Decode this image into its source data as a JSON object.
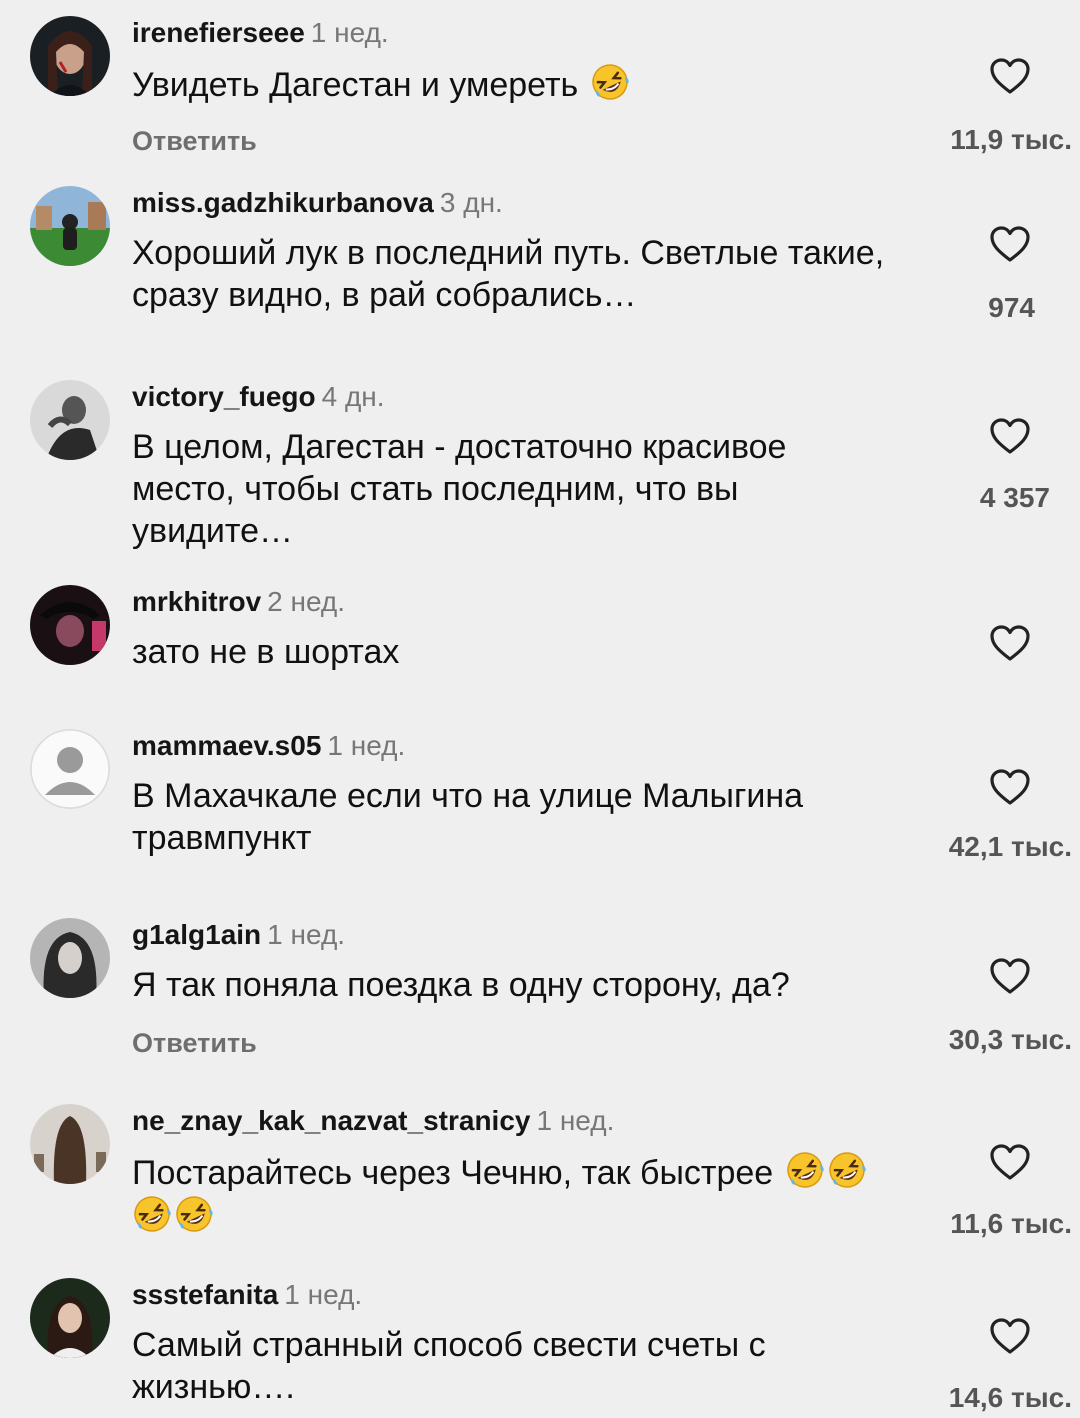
{
  "comments": [
    {
      "username": "irenefierseee",
      "time": "1 нед.",
      "text": "Увидеть Дагестан и умереть",
      "emoji_count": 1,
      "reply": "Ответить",
      "likes": "11,9 тыс."
    },
    {
      "username": "miss.gadzhikurbanova",
      "time": "3 дн.",
      "text": "Хороший лук в последний путь. Светлые такие, сразу видно, в рай собрались…",
      "emoji_count": 0,
      "likes": "974"
    },
    {
      "username": "victory_fuego",
      "time": "4 дн.",
      "text": "В целом, Дагестан - достаточно красивое место, чтобы стать последним, что вы увидите…",
      "emoji_count": 0,
      "likes": "4 357"
    },
    {
      "username": "mrkhitrov",
      "time": "2 нед.",
      "text": "зато не в шортах",
      "emoji_count": 0
    },
    {
      "username": "mammaev.s05",
      "time": "1 нед.",
      "text": "В Махачкале если что на улице Малыгина травмпункт",
      "emoji_count": 0,
      "likes": "42,1 тыс."
    },
    {
      "username": "g1alg1ain",
      "time": "1 нед.",
      "text": "Я так поняла поездка в одну сторону, да?",
      "emoji_count": 0,
      "reply": "Ответить",
      "likes": "30,3 тыс."
    },
    {
      "username": "ne_znay_kak_nazvat_stranicy",
      "time": "1 нед.",
      "text": "Постарайтесь через Чечню, так быстрее",
      "emoji_count": 4,
      "likes": "11,6 тыс."
    },
    {
      "username": "ssstefanita",
      "time": "1 нед.",
      "text": "Самый странный способ свести счеты с жизнью….",
      "emoji_count": 0,
      "likes": "14,6 тыс."
    }
  ],
  "icons": {
    "like": "heart-outline-icon",
    "emoji": "rofl-emoji-icon",
    "avatar_default": "default-avatar-icon"
  },
  "colors": {
    "background": "#efefef",
    "username": "#151515",
    "time": "#777777",
    "likes": "#555555"
  }
}
